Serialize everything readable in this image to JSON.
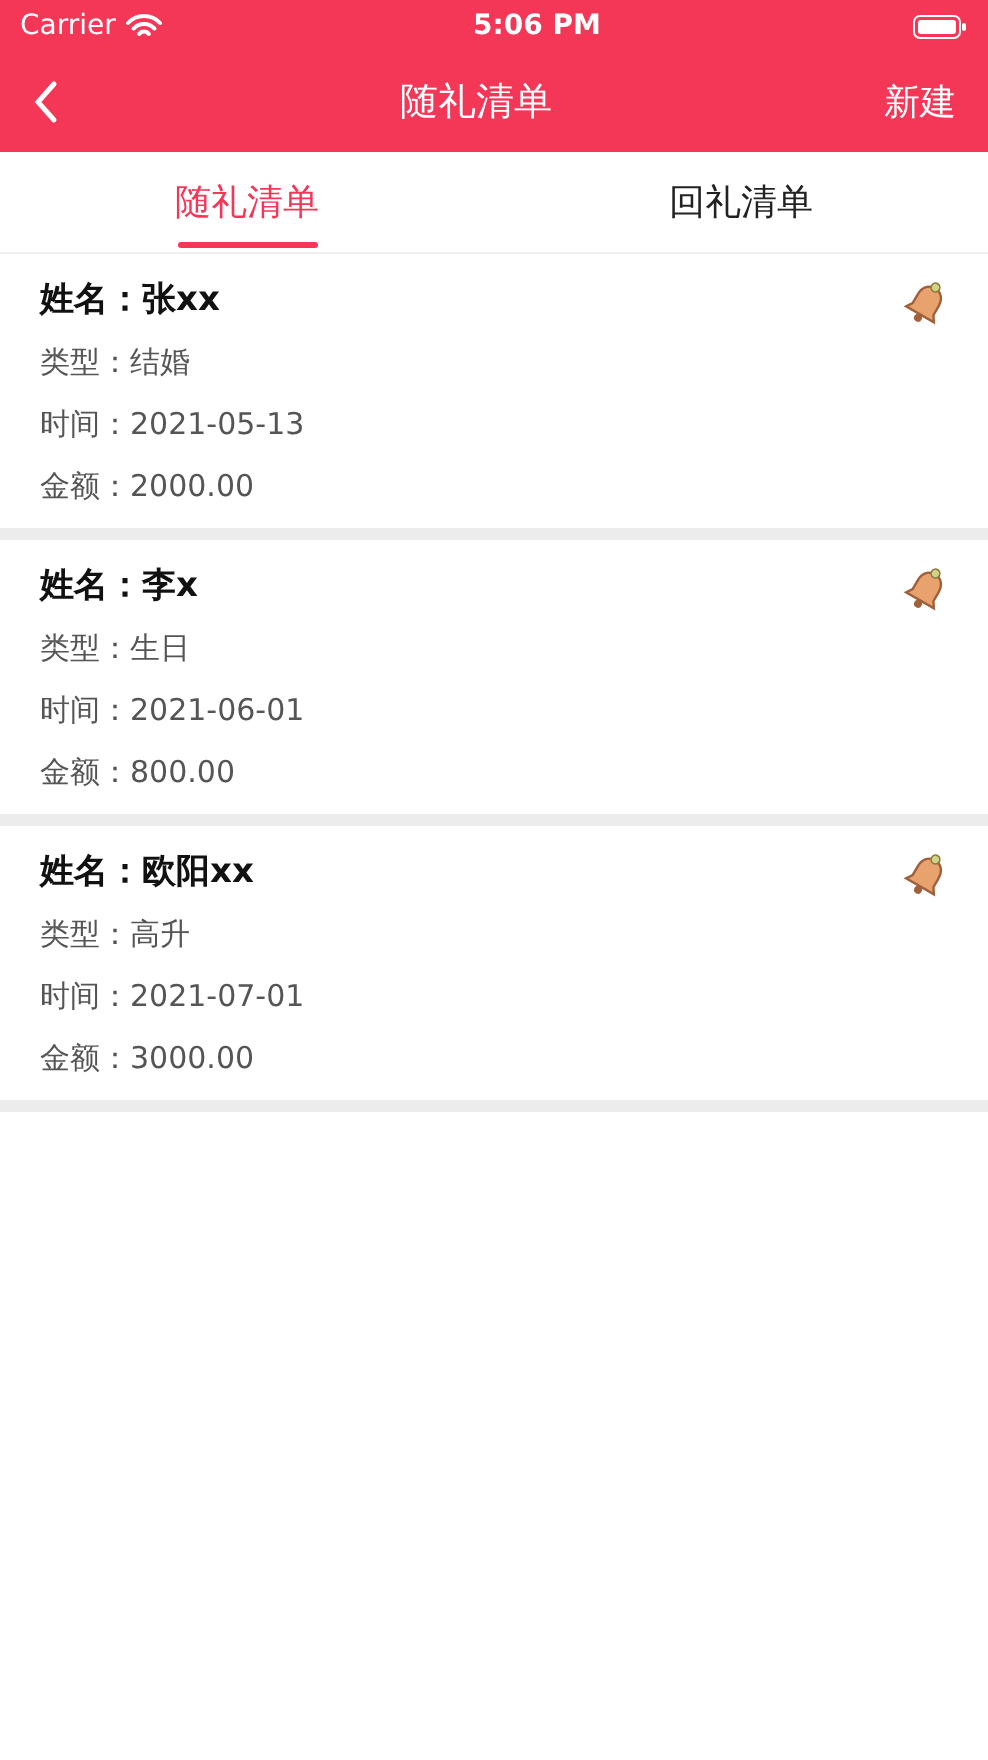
{
  "status_bar": {
    "carrier": "Carrier",
    "time": "5:06 PM"
  },
  "nav_bar": {
    "title": "随礼清单",
    "action": "新建"
  },
  "tabs": [
    {
      "label": "随礼清单",
      "selected": true
    },
    {
      "label": "回礼清单",
      "selected": false
    }
  ],
  "records": [
    {
      "name": "姓名：张xx",
      "type": "类型：结婚",
      "date": "时间：2021-05-13",
      "amount": "金额：2000.00"
    },
    {
      "name": "姓名：李x",
      "type": "类型：生日",
      "date": "时间：2021-06-01",
      "amount": "金额：800.00"
    },
    {
      "name": "姓名：欧阳xx",
      "type": "类型：高升",
      "date": "时间：2021-07-01",
      "amount": "金额：3000.00"
    }
  ]
}
